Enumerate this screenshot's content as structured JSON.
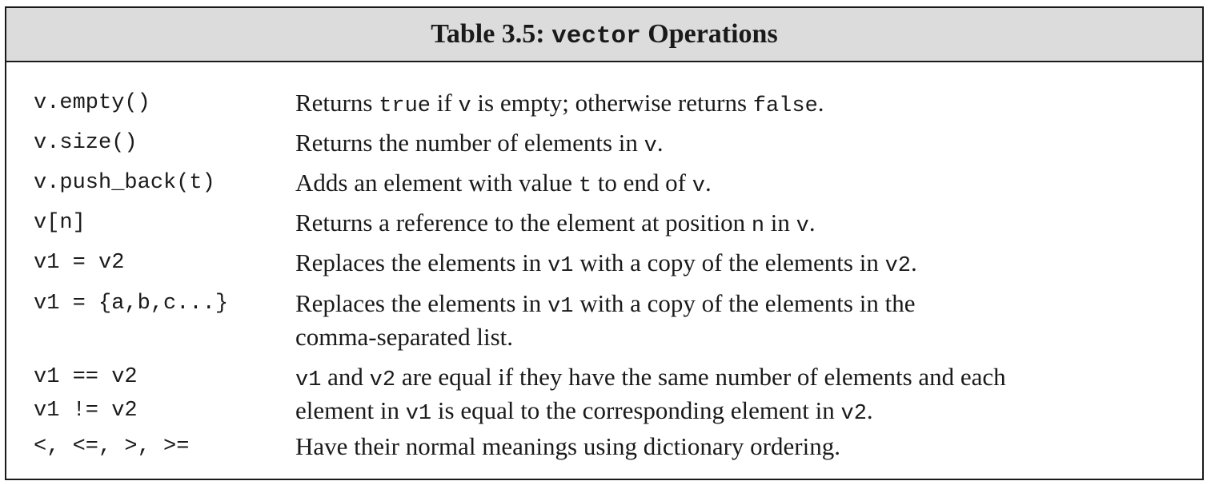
{
  "title": {
    "prefix": "Table 3.5: ",
    "code": "vector",
    "suffix": " Operations"
  },
  "rows": [
    {
      "op": "v.empty()",
      "desc": [
        [
          "Returns ",
          ""
        ],
        [
          "true",
          "c"
        ],
        [
          " if ",
          ""
        ],
        [
          "v",
          "c"
        ],
        [
          " is empty; otherwise returns ",
          ""
        ],
        [
          "false",
          "c"
        ],
        [
          ".",
          ""
        ]
      ]
    },
    {
      "op": "v.size()",
      "desc": [
        [
          "Returns the number of elements in ",
          ""
        ],
        [
          "v",
          "c"
        ],
        [
          ".",
          ""
        ]
      ]
    },
    {
      "op": "v.push_back(t)",
      "desc": [
        [
          "Adds an element with value ",
          ""
        ],
        [
          "t",
          "c"
        ],
        [
          " to end of ",
          ""
        ],
        [
          "v",
          "c"
        ],
        [
          ".",
          ""
        ]
      ]
    },
    {
      "op": "v[n]",
      "desc": [
        [
          "Returns a reference to the element at position ",
          ""
        ],
        [
          "n",
          "c"
        ],
        [
          " in ",
          ""
        ],
        [
          "v",
          "c"
        ],
        [
          ".",
          ""
        ]
      ]
    },
    {
      "op": "v1 = v2",
      "desc": [
        [
          "Replaces the elements in ",
          ""
        ],
        [
          "v1",
          "c"
        ],
        [
          " with a copy of the elements in ",
          ""
        ],
        [
          "v2",
          "c"
        ],
        [
          ".",
          ""
        ]
      ]
    },
    {
      "op": "v1 = {a,b,c...}",
      "desc": [
        [
          "Replaces the elements in ",
          ""
        ],
        [
          "v1",
          "c"
        ],
        [
          " with a copy of the elements in the",
          ""
        ]
      ],
      "desc2": [
        [
          "comma-separated list.",
          ""
        ]
      ]
    },
    {
      "op": "v1 == v2",
      "op2": "v1 != v2",
      "desc": [
        [
          "v1",
          "c"
        ],
        [
          " and ",
          ""
        ],
        [
          "v2",
          "c"
        ],
        [
          " are equal if they have the same number of elements and each",
          ""
        ]
      ],
      "desc2": [
        [
          "element in ",
          ""
        ],
        [
          "v1",
          "c"
        ],
        [
          " is equal to the corresponding element in ",
          ""
        ],
        [
          "v2",
          "c"
        ],
        [
          ".",
          ""
        ]
      ]
    },
    {
      "op": "<, <=, >, >=",
      "desc": [
        [
          "Have their normal meanings using dictionary ordering.",
          ""
        ]
      ]
    }
  ]
}
